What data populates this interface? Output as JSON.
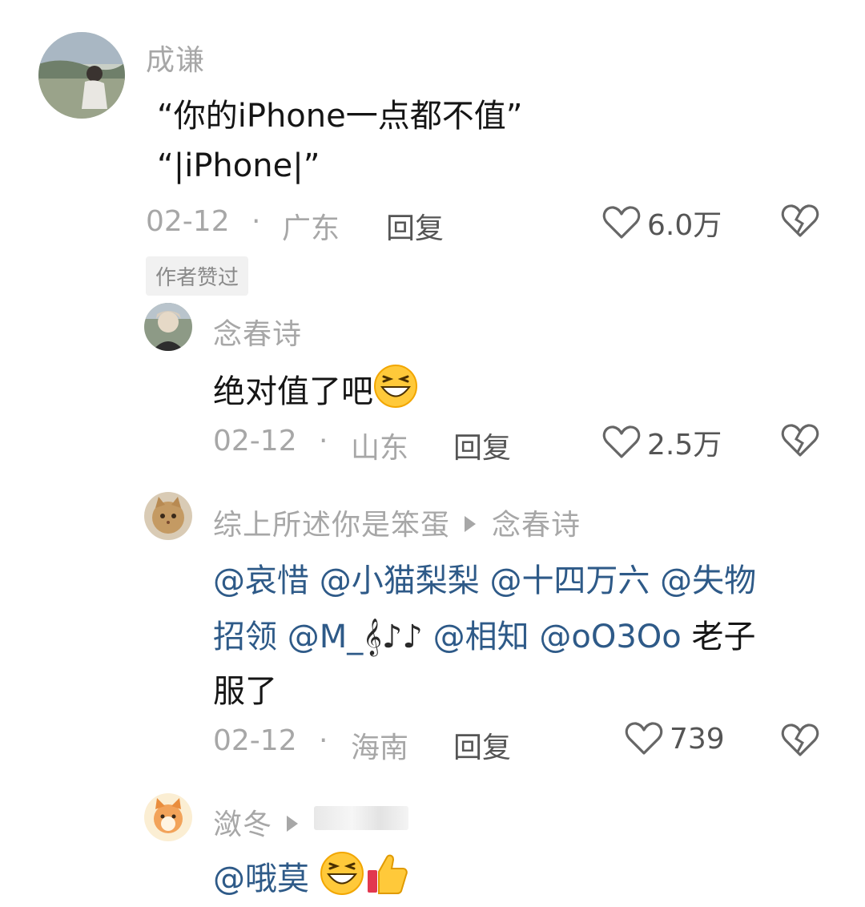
{
  "comments": [
    {
      "username": "成谦",
      "lines": [
        "“你的iPhone一点都不值”",
        "“|iPhone|”"
      ],
      "date": "02-12",
      "separator": "·",
      "location": "广东",
      "reply_label": "回复",
      "like_count": "6.0万",
      "badge": "作者赞过"
    },
    {
      "username": "念春诗",
      "text": "绝对值了吧",
      "emoji": "grinning-squint-emoji",
      "date": "02-12",
      "separator": "·",
      "location": "山东",
      "reply_label": "回复",
      "like_count": "2.5万"
    },
    {
      "username": "综上所述你是笨蛋",
      "reply_to": "念春诗",
      "line1": [
        "@哀惜",
        "@小猫梨梨",
        "@十四万六",
        "@失物"
      ],
      "line2_prefix": "招领",
      "line2_m": "@M_",
      "line2_notes": "𝄞♪♪",
      "line2_mentions": [
        "@相知",
        "@oO3Oo"
      ],
      "line2_suffix": "老子",
      "line3": "服了",
      "date": "02-12",
      "separator": "·",
      "location": "海南",
      "reply_label": "回复",
      "like_count": "739"
    },
    {
      "username": "潋冬",
      "mention": "@哦莫",
      "emojis": [
        "grinning-squint-emoji",
        "thumbs-up-emoji"
      ]
    }
  ],
  "colors": {
    "username": "#a7a7a7",
    "mention": "#2e5a88",
    "text": "#151515",
    "meta": "#a7a7a7",
    "badge_bg": "#f1f1f1"
  }
}
